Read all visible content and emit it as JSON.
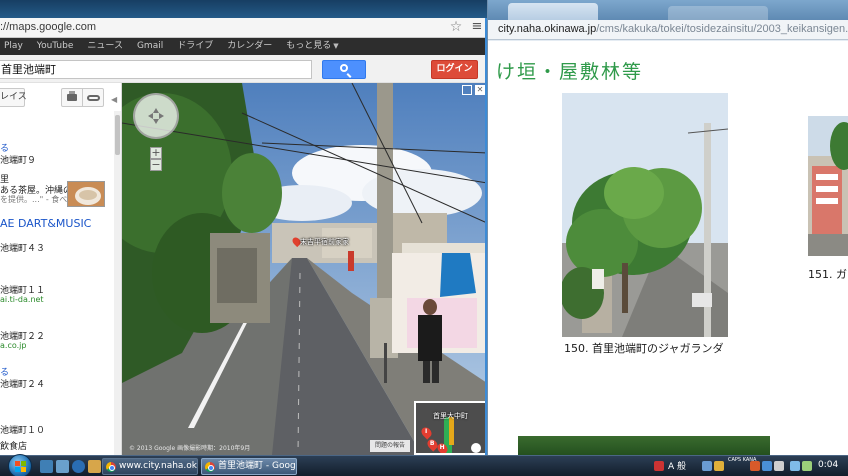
{
  "left_browser": {
    "url": "://maps.google.com",
    "gbar": {
      "items": [
        "Play",
        "YouTube",
        "ニュース",
        "Gmail",
        "ドライブ",
        "カレンダー",
        "もっと見る"
      ]
    },
    "search": {
      "query": "首里池端町",
      "login_label": "ログイン"
    },
    "sidebar": {
      "places_label": "レイス",
      "results": [
        {
          "kind": "link",
          "text": "る"
        },
        {
          "kind": "text",
          "text": "池端町９"
        },
        {
          "kind": "text",
          "text": "里"
        },
        {
          "kind": "text",
          "text": "ある茶屋。沖縄の"
        },
        {
          "kind": "text",
          "text": "を提供。...\"  - 食べログ.com"
        },
        {
          "kind": "title",
          "text": "AE DART&MUSIC"
        },
        {
          "kind": "text",
          "text": "池端町４３"
        },
        {
          "kind": "text",
          "text": "池端町１１"
        },
        {
          "kind": "green",
          "text": "ai.ti-da.net"
        },
        {
          "kind": "text",
          "text": "池端町２２"
        },
        {
          "kind": "green",
          "text": "a.co.jp"
        },
        {
          "kind": "link",
          "text": "る"
        },
        {
          "kind": "text",
          "text": "池端町２４"
        },
        {
          "kind": "text",
          "text": "池端町１０"
        },
        {
          "kind": "text",
          "text": "飲食店"
        }
      ]
    }
  },
  "streetview": {
    "place_label": "末吉平宿前家家",
    "copyright": "© 2013 Google   画像撮影時期：2010年9月",
    "report_label": "問題の報告",
    "minimap_label": "首里大中町",
    "markers": [
      "I",
      "B",
      "H"
    ]
  },
  "right_browser": {
    "url_host": "city.naha.okinawa.jp",
    "url_path": "/cms/kakuka/tokei/tosidezainsitu/2003_keikansigen.pdf",
    "heading": "け垣・屋敷林等",
    "caption_150": "150. 首里池端町のジャガランダ",
    "caption_151": "151. ガ"
  },
  "taskbar": {
    "tasks": [
      {
        "label": "www.city.naha.ok...",
        "active": false
      },
      {
        "label": "首里池端町 - Goog...",
        "active": true
      }
    ],
    "ime": "A 般",
    "caps": "CAPS KANA",
    "clock": "0:04"
  },
  "colors": {
    "search_blue": "#4d90fe",
    "login_red": "#dd4b39",
    "gbar_bg": "#2d2d2d",
    "pdf_heading_green": "#2f9a4a",
    "link_blue": "#1a55c9"
  }
}
